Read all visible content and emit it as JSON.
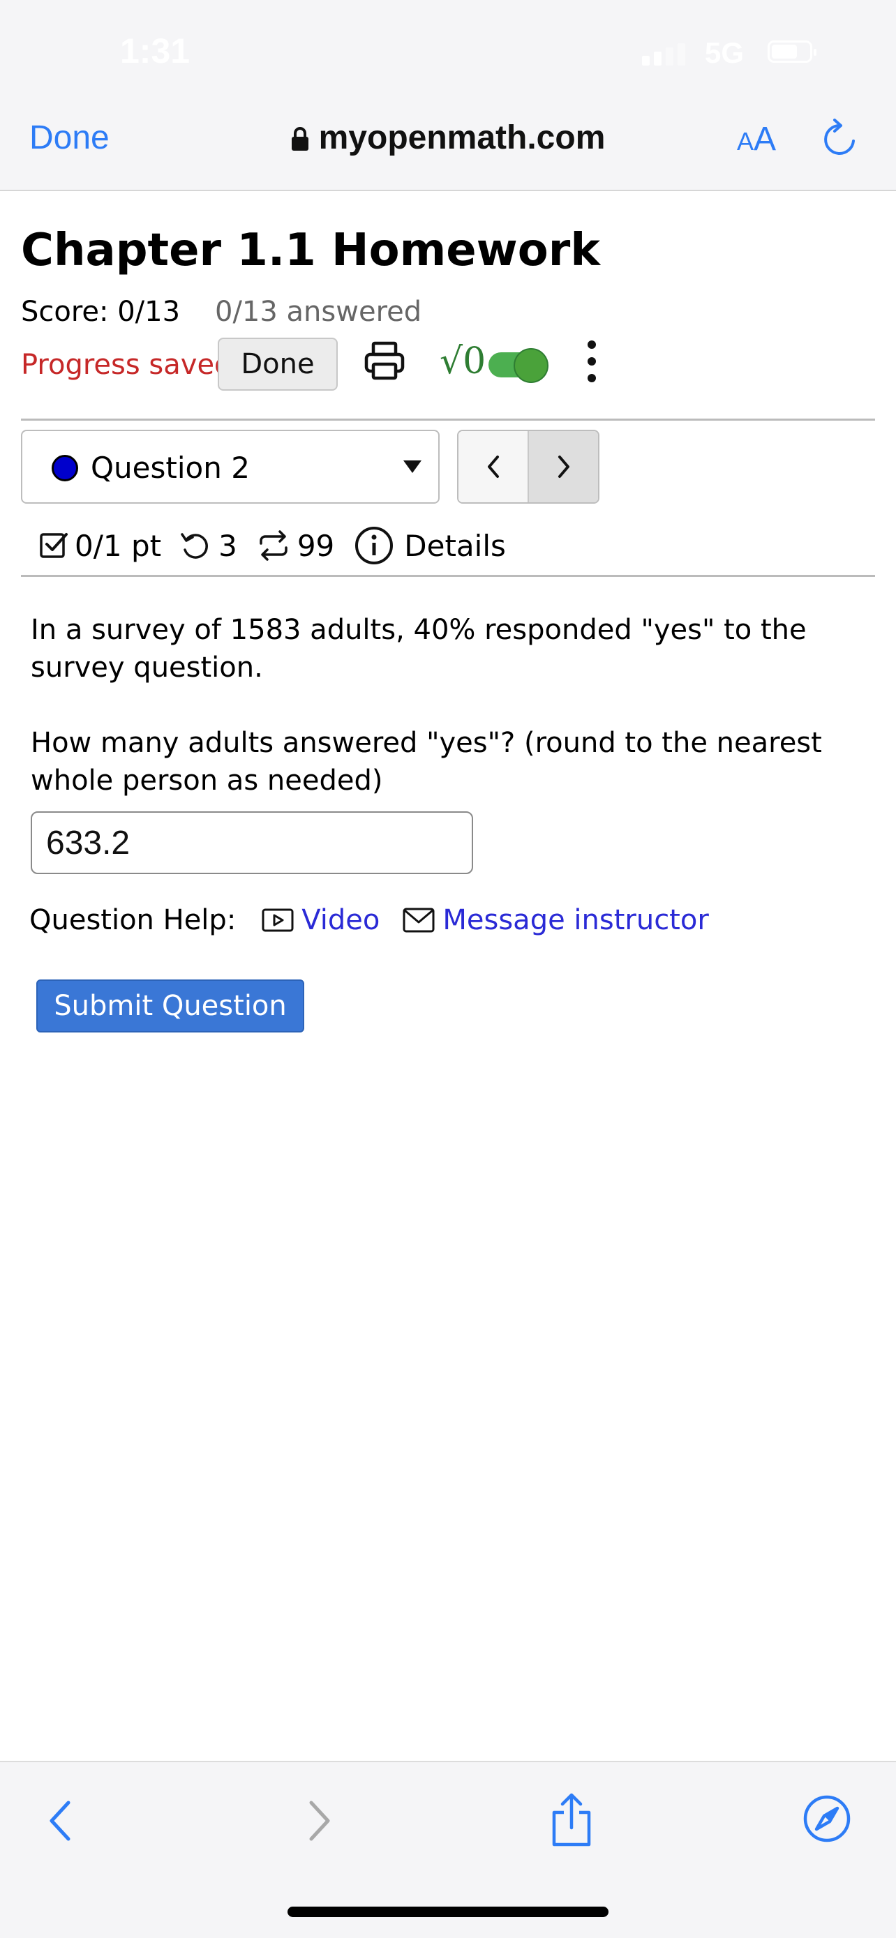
{
  "status": {
    "time": "1:31",
    "network": "5G"
  },
  "browser": {
    "done_label": "Done",
    "url": "myopenmath.com",
    "aa_small": "A",
    "aa_big": "A"
  },
  "page": {
    "title": "Chapter 1.1 Homework",
    "score": "Score: 0/13",
    "answered": "0/13 answered",
    "progress_saved": "Progress saved",
    "done_button": "Done",
    "math_toggle_label": "√0"
  },
  "question_nav": {
    "selected": "Question 2"
  },
  "meta": {
    "points": "0/1 pt",
    "retries": "3",
    "attempts": "99",
    "details": "Details"
  },
  "question": {
    "text1": "In a survey of 1583 adults, 40% responded \"yes\" to the survey question.",
    "text2": "How many adults answered \"yes\"? (round to the nearest whole person as needed)",
    "answer_value": "633.2"
  },
  "help": {
    "label": "Question Help:",
    "video": "Video",
    "message": "Message instructor"
  },
  "submit_label": "Submit Question",
  "colors": {
    "accent": "#2d7cf6",
    "saved_red": "#c62828",
    "link_blue": "#2a2ad6",
    "submit_blue": "#3a77d6",
    "toggle_green": "#4caf50"
  },
  "icons": [
    "lock-icon",
    "reload-icon",
    "print-icon",
    "kebab-menu-icon",
    "checkbox-icon",
    "retry-icon",
    "attempts-icon",
    "info-icon",
    "video-icon",
    "mail-icon",
    "back-icon",
    "forward-icon",
    "share-icon",
    "compass-icon"
  ]
}
